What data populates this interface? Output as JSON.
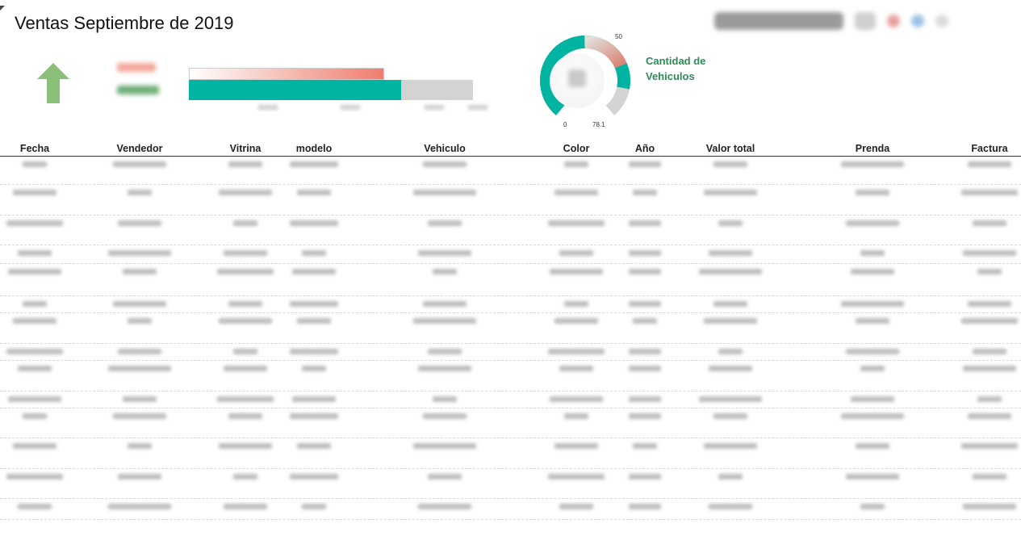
{
  "header": {
    "title": "Ventas Septiembre de 2019",
    "toolbar_placeholder": ""
  },
  "kpi": {
    "trend": "up",
    "trend_color": "#8cc07a",
    "label_top": "",
    "label_top_color": "#f07d6d",
    "label_bottom": "",
    "label_bottom_color": "#2e8b57",
    "bullet_actual_fraction": 0.68,
    "bullet_target_fraction": 0.91,
    "bullet_actual_color": "#00b4a2",
    "bullet_target_color": "#f07d6d",
    "ticks": [
      "",
      "",
      "",
      ""
    ]
  },
  "gauge": {
    "title_line1": "Cantidad de",
    "title_line2": "Vehiculos",
    "min_label": "0",
    "max_label": "78.1",
    "target_label": "50",
    "min": 0,
    "max": 78.1,
    "target": 50,
    "value_fraction": 0.86,
    "fill_color": "#00b4a2",
    "target_color": "#f07d6d",
    "track_color": "#d3d3d3"
  },
  "table": {
    "columns": [
      "Fecha",
      "Vendedor",
      "Vitrina",
      "modelo",
      "Vehiculo",
      "Color",
      "Año",
      "Valor total",
      "Prenda",
      "Factura"
    ],
    "rows": [
      [
        "",
        "",
        "",
        "",
        "",
        "",
        "",
        "",
        "",
        ""
      ],
      [
        "",
        "",
        "",
        "",
        "",
        "",
        "",
        "",
        "",
        ""
      ],
      [
        "",
        "",
        "",
        "",
        "",
        "",
        "",
        "",
        "",
        ""
      ],
      [
        "",
        "",
        "",
        "",
        "",
        "",
        "",
        "",
        "",
        ""
      ],
      [
        "",
        "",
        "",
        "",
        "",
        "",
        "",
        "",
        "",
        ""
      ],
      [
        "",
        "",
        "",
        "",
        "",
        "",
        "",
        "",
        "",
        ""
      ],
      [
        "",
        "",
        "",
        "",
        "",
        "",
        "",
        "",
        "",
        ""
      ],
      [
        "",
        "",
        "",
        "",
        "",
        "",
        "",
        "",
        "",
        ""
      ],
      [
        "",
        "",
        "",
        "",
        "",
        "",
        "",
        "",
        "",
        ""
      ],
      [
        "",
        "",
        "",
        "",
        "",
        "",
        "",
        "",
        "",
        ""
      ],
      [
        "",
        "",
        "",
        "",
        "",
        "",
        "",
        "",
        "",
        ""
      ],
      [
        "",
        "",
        "",
        "",
        "",
        "",
        "",
        "",
        "",
        ""
      ],
      [
        "",
        "",
        "",
        "",
        "",
        "",
        "",
        "",
        "",
        ""
      ],
      [
        "",
        "",
        "",
        "",
        "",
        "",
        "",
        "",
        "",
        ""
      ]
    ]
  }
}
